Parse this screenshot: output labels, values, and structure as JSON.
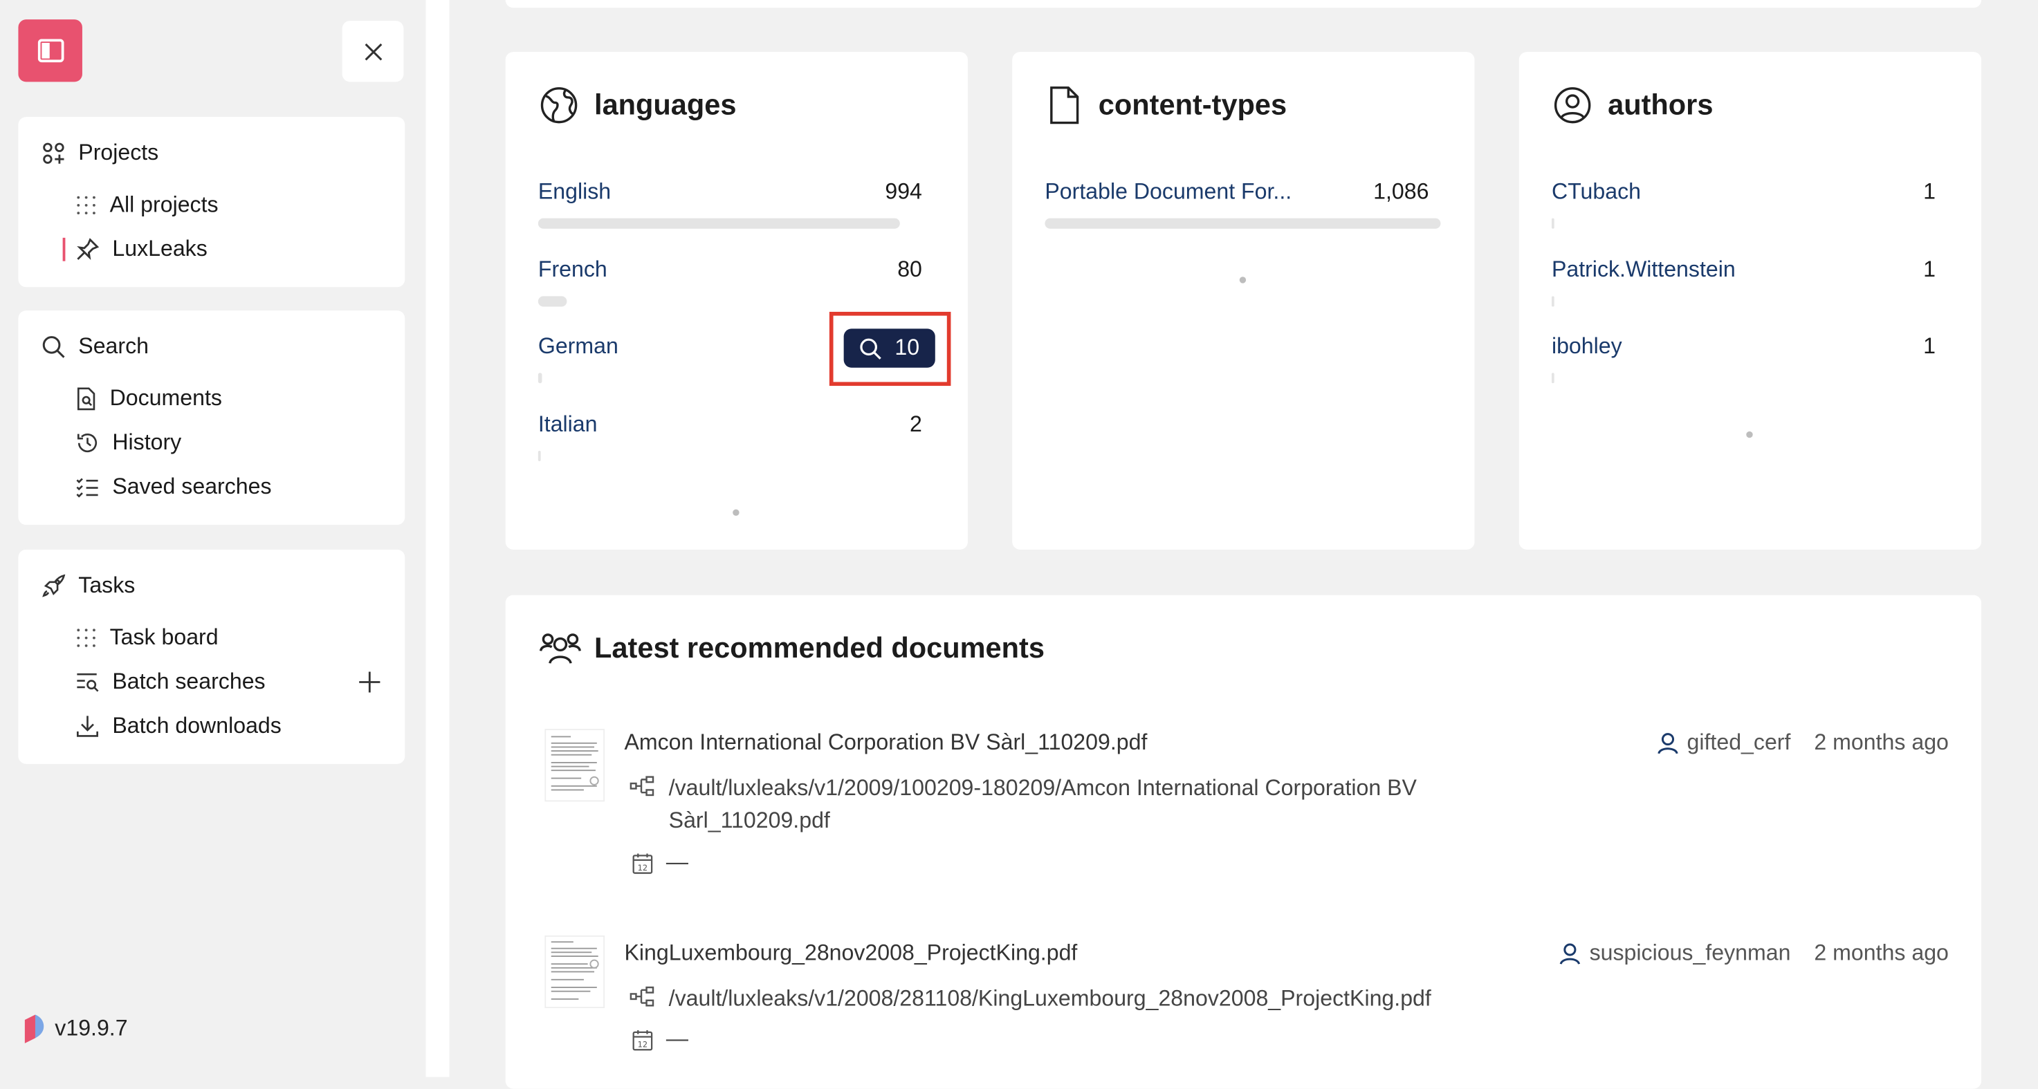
{
  "sidebar": {
    "projects": {
      "heading": "Projects",
      "items": [
        {
          "label": "All projects",
          "icon": "grid-dots-icon"
        },
        {
          "label": "LuxLeaks",
          "icon": "pin-icon"
        }
      ]
    },
    "search": {
      "heading": "Search",
      "items": [
        {
          "label": "Documents",
          "icon": "document-search-icon"
        },
        {
          "label": "History",
          "icon": "history-icon"
        },
        {
          "label": "Saved searches",
          "icon": "checklist-icon"
        }
      ]
    },
    "tasks": {
      "heading": "Tasks",
      "items": [
        {
          "label": "Task board",
          "icon": "grid-dots-icon"
        },
        {
          "label": "Batch searches",
          "icon": "list-search-icon"
        },
        {
          "label": "Batch downloads",
          "icon": "download-icon"
        }
      ]
    },
    "version": "v19.9.7",
    "accent_color": "#e8526f"
  },
  "stats": {
    "languages": {
      "title": "languages",
      "rows": [
        {
          "label": "English",
          "count": "994",
          "fill": 1.0
        },
        {
          "label": "French",
          "count": "80",
          "fill": 0.08
        },
        {
          "label": "German",
          "count": "10",
          "fill": 0.01
        },
        {
          "label": "Italian",
          "count": "2",
          "fill": 0.002
        }
      ]
    },
    "content_types": {
      "title": "content-types",
      "rows": [
        {
          "label": "Portable Document For...",
          "count": "1,086",
          "fill": 1.0
        }
      ]
    },
    "authors": {
      "title": "authors",
      "rows": [
        {
          "label": "CTubach",
          "count": "1",
          "fill": 0.002
        },
        {
          "label": "Patrick.Wittenstein",
          "count": "1",
          "fill": 0.002
        },
        {
          "label": "ibohley",
          "count": "1",
          "fill": 0.002
        }
      ]
    },
    "highlight_color": "#e23b2e",
    "pill_color": "#17244a"
  },
  "recommended": {
    "title": "Latest recommended documents",
    "documents": [
      {
        "name": "Amcon International Corporation BV Sàrl_110209.pdf",
        "path": "/vault/luxleaks/v1/2009/100209-180209/Amcon International Corporation BV Sàrl_110209.pdf",
        "date": "—",
        "user": "gifted_cerf",
        "time": "2 months ago"
      },
      {
        "name": "KingLuxembourg_28nov2008_ProjectKing.pdf",
        "path": "/vault/luxleaks/v1/2008/281108/KingLuxembourg_28nov2008_ProjectKing.pdf",
        "date": "—",
        "user": "suspicious_feynman",
        "time": "2 months ago"
      }
    ]
  }
}
